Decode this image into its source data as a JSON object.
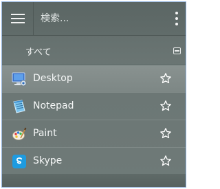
{
  "header": {
    "menu_icon": "hamburger-icon",
    "search_placeholder": "検索...",
    "more_icon": "vertical-ellipsis-icon"
  },
  "section": {
    "title": "すべて",
    "collapse_icon": "collapse-box-icon"
  },
  "apps": [
    {
      "label": "Desktop",
      "icon": "desktop-icon",
      "favorite_icon": "star-outline-icon"
    },
    {
      "label": "Notepad",
      "icon": "notepad-icon",
      "favorite_icon": "star-outline-icon"
    },
    {
      "label": "Paint",
      "icon": "paint-palette-icon",
      "favorite_icon": "star-outline-icon"
    },
    {
      "label": "Skype",
      "icon": "skype-icon",
      "favorite_icon": "star-outline-icon"
    }
  ],
  "colors": {
    "background": "#6b7674",
    "selected_row": "#859090",
    "text": "#f4f6f6",
    "skype_blue": "#1e9be0"
  }
}
